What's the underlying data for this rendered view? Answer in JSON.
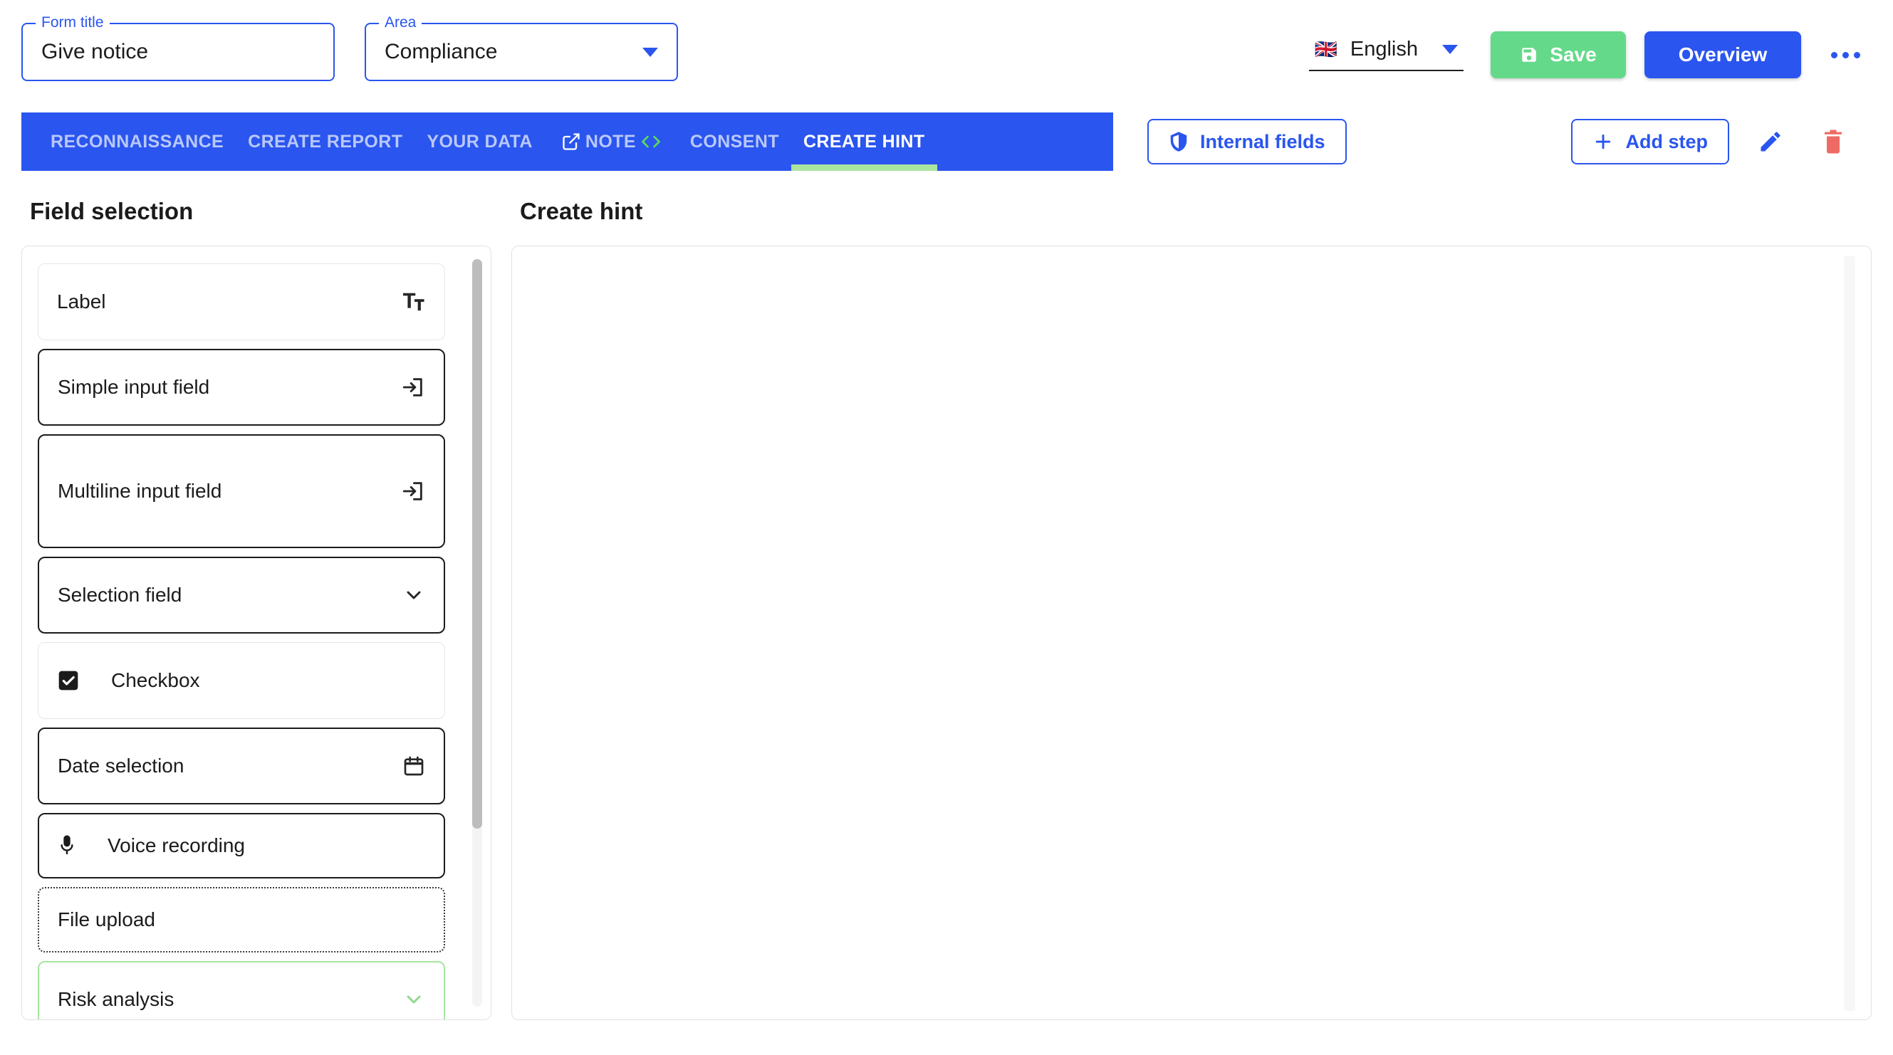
{
  "header": {
    "form_title": {
      "legend": "Form title",
      "value": "Give notice"
    },
    "area": {
      "legend": "Area",
      "value": "Compliance"
    },
    "language": {
      "flag": "uk-flag-icon",
      "name": "English",
      "caret": "chevron-down-icon"
    },
    "save_label": "Save",
    "overview_label": "Overview",
    "more_label": "more-options-icon"
  },
  "tabs": [
    {
      "label": "RECONNAISSANCE",
      "active": false,
      "icon_before": "",
      "icon_after": ""
    },
    {
      "label": "CREATE REPORT",
      "active": false,
      "icon_before": "",
      "icon_after": ""
    },
    {
      "label": "YOUR DATA",
      "active": false,
      "icon_before": "",
      "icon_after": ""
    },
    {
      "label": "NOTE",
      "active": false,
      "icon_before": "external-link-icon",
      "icon_after": "code-brackets-icon"
    },
    {
      "label": "CONSENT",
      "active": false,
      "icon_before": "",
      "icon_after": ""
    },
    {
      "label": "CREATE HINT",
      "active": true,
      "icon_before": "",
      "icon_after": ""
    }
  ],
  "toolbar": {
    "internal_fields_label": "Internal fields",
    "internal_fields_icon": "shield-icon",
    "add_step_label": "Add step",
    "add_step_icon": "plus-icon",
    "edit_icon": "pencil-icon",
    "delete_icon": "trash-icon"
  },
  "left_panel": {
    "title": "Field selection",
    "fields": [
      {
        "label": "Label",
        "icon": "text-format-icon",
        "icon_side": "right",
        "style": "light",
        "size": "h-md"
      },
      {
        "label": "Simple input field",
        "icon": "input-arrow-icon",
        "icon_side": "right",
        "style": "normal",
        "size": "h-md"
      },
      {
        "label": "Multiline input field",
        "icon": "input-arrow-icon",
        "icon_side": "right",
        "style": "normal",
        "size": "h-lg"
      },
      {
        "label": "Selection field",
        "icon": "chevron-down-icon",
        "icon_side": "right",
        "style": "normal",
        "size": "h-md"
      },
      {
        "label": "Checkbox",
        "icon": "checkbox-checked-icon",
        "icon_side": "left",
        "style": "light",
        "size": "h-md"
      },
      {
        "label": "Date selection",
        "icon": "calendar-icon",
        "icon_side": "right",
        "style": "normal",
        "size": "h-md"
      },
      {
        "label": "Voice recording",
        "icon": "microphone-icon",
        "icon_side": "left",
        "style": "normal",
        "size": "h-sm"
      },
      {
        "label": "File upload",
        "icon": "",
        "icon_side": "none",
        "style": "dotted",
        "size": "h-sm"
      },
      {
        "label": "Risk analysis",
        "icon": "chevron-down-icon",
        "icon_side": "right",
        "style": "green",
        "size": "h-md"
      }
    ]
  },
  "right_panel": {
    "title": "Create hint",
    "dropzone_content": ""
  },
  "colors": {
    "primary_blue": "#2a55ef",
    "save_green": "#65d98a",
    "accent_green": "#aae5a0",
    "danger_red": "#ef6a64",
    "tab_inactive": "#b9c8fb",
    "text": "#1b1b1b"
  }
}
